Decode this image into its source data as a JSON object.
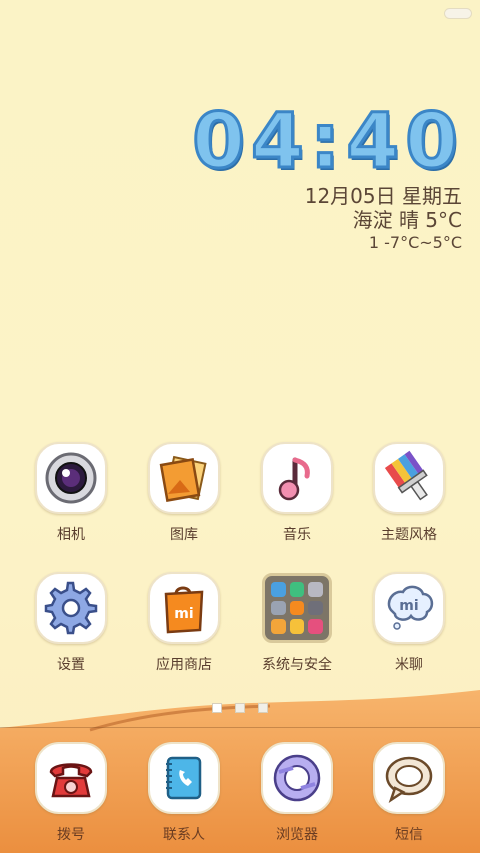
{
  "clock": {
    "time": "04:40"
  },
  "date": {
    "date_line": "12月05日 星期五",
    "weather_line": "海淀 晴 5°C",
    "temp_range": "1 -7°C~5°C"
  },
  "apps": [
    {
      "label": "相机",
      "icon": "camera-icon"
    },
    {
      "label": "图库",
      "icon": "gallery-icon"
    },
    {
      "label": "音乐",
      "icon": "music-icon"
    },
    {
      "label": "主题风格",
      "icon": "theme-brush-icon"
    },
    {
      "label": "设置",
      "icon": "settings-gear-icon"
    },
    {
      "label": "应用商店",
      "icon": "app-store-bag-icon"
    },
    {
      "label": "系统与安全",
      "icon": "system-folder-icon"
    },
    {
      "label": "米聊",
      "icon": "miliao-chat-icon"
    }
  ],
  "dock": [
    {
      "label": "拨号",
      "icon": "phone-icon"
    },
    {
      "label": "联系人",
      "icon": "contacts-icon"
    },
    {
      "label": "浏览器",
      "icon": "browser-icon"
    },
    {
      "label": "短信",
      "icon": "messages-icon"
    }
  ],
  "colors": {
    "background": "#fcf3c7",
    "clock": "#7fc3ee",
    "hill": "#f0a354"
  }
}
